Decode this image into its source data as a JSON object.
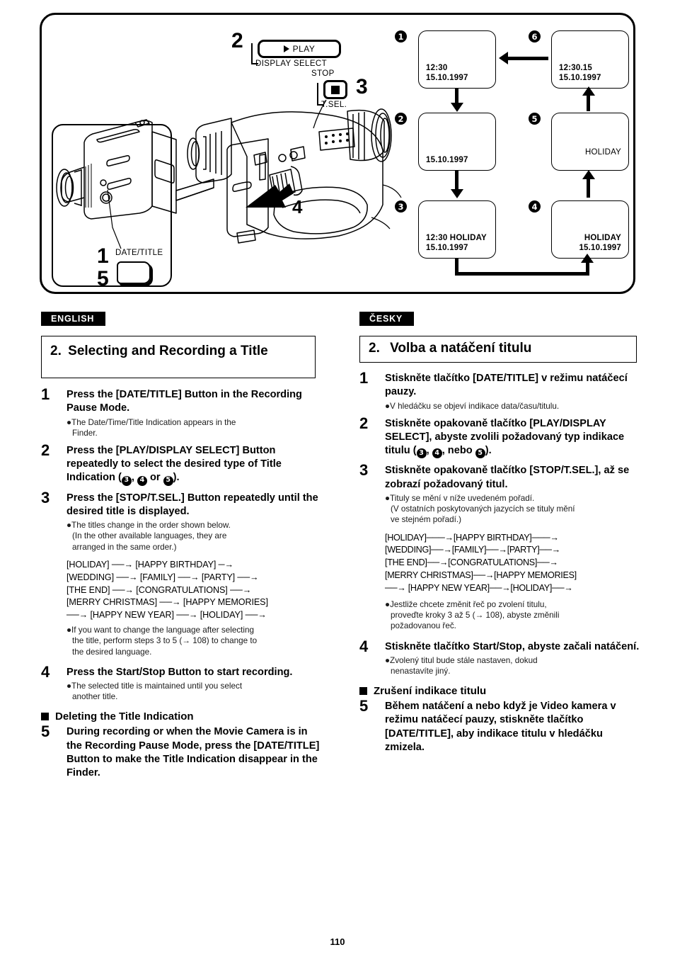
{
  "illustration": {
    "buttons": {
      "play_label": "PLAY",
      "play_sub_label": "DISPLAY SELECT",
      "play_step_num": "2",
      "stop_top_label": "STOP",
      "stop_sub_label": "T.SEL.",
      "stop_step_num": "3"
    },
    "camera_callouts": {
      "date_title_label": "DATE/TITLE",
      "num_1": "1",
      "num_5": "5",
      "num_4": "4"
    },
    "finder_screens": [
      {
        "num": "1",
        "marker": "❶",
        "align": "left",
        "lines": [
          "12:30",
          "15.10.1997"
        ]
      },
      {
        "num": "2",
        "marker": "❷",
        "align": "left",
        "lines": [
          "15.10.1997"
        ]
      },
      {
        "num": "3",
        "marker": "❸",
        "align": "left",
        "lines": [
          "12:30   HOLIDAY",
          "15.10.1997"
        ]
      },
      {
        "num": "4",
        "marker": "❹",
        "align": "right",
        "lines": [
          "HOLIDAY",
          "15.10.1997"
        ]
      },
      {
        "num": "5",
        "marker": "❺",
        "align": "right",
        "lines": [
          "HOLIDAY"
        ]
      },
      {
        "num": "6",
        "marker": "❻",
        "align": "left",
        "lines": [
          "12:30.15",
          "15.10.1997"
        ]
      }
    ]
  },
  "english": {
    "lang_tag": "ENGLISH",
    "section_number": "2.",
    "section_title": "Selecting and Recording a Title",
    "steps": [
      {
        "n": "1",
        "head": "Press the [DATE/TITLE] Button in the Recording Pause Mode.",
        "notes": [
          "●The Date/Time/Title Indication appears in the",
          "Finder."
        ]
      },
      {
        "n": "2",
        "head_pre": "Press the [PLAY/DISPLAY SELECT] Button repeatedly to select the desired type of Title Indication (",
        "head_post": ").",
        "head_mid_1": ", ",
        "head_mid_2": " or ",
        "circle_a": "3",
        "circle_b": "4",
        "circle_c": "5"
      },
      {
        "n": "3",
        "head": "Press the [STOP/T.SEL.] Button repeatedly until the desired title is displayed.",
        "notes": [
          "●The titles change in the order shown below.",
          "(In the other available languages, they are",
          "arranged in the same order.)"
        ],
        "sequence": [
          "[HOLIDAY] ──→ [HAPPY BIRTHDAY] ─→",
          "[WEDDING] ──→ [FAMILY] ──→ [PARTY] ──→",
          "[THE END] ──→ [CONGRATULATIONS] ──→",
          "[MERRY CHRISTMAS] ──→ [HAPPY MEMORIES]",
          "──→ [HAPPY NEW YEAR] ──→ [HOLIDAY] ──→"
        ],
        "notes2": [
          "●If you want to change the language after selecting",
          "the title, perform steps 3 to 5 (→ 108) to change to",
          "the desired language."
        ]
      },
      {
        "n": "4",
        "head": "Press the Start/Stop Button to start recording.",
        "notes": [
          "●The selected title is maintained until you select",
          "another title."
        ]
      }
    ],
    "subhead": "Deleting the Title Indication",
    "step5": {
      "n": "5",
      "head": "During recording or when the Movie Camera is in the Recording Pause Mode, press the [DATE/TITLE] Button to make the Title Indication disappear in the Finder."
    }
  },
  "czech": {
    "lang_tag": "ČESKY",
    "section_number": "2.",
    "section_title": "Volba a natáčení titulu",
    "steps": [
      {
        "n": "1",
        "head": "Stiskněte tlačítko [DATE/TITLE] v režimu natáčecí pauzy.",
        "notes": [
          "●V hledáčku se objeví indikace data/času/titulu."
        ]
      },
      {
        "n": "2",
        "head_pre": "Stiskněte opakovaně tlačítko [PLAY/DISPLAY SELECT], abyste zvolili požadovaný typ indikace titulu (",
        "head_mid_1": ", ",
        "head_mid_2": ", nebo ",
        "head_post": ").",
        "circle_a": "3",
        "circle_b": "4",
        "circle_c": "5"
      },
      {
        "n": "3",
        "head": "Stiskněte opakovaně tlačítko [STOP/T.SEL.], až se zobrazí požadovaný titul.",
        "notes": [
          "●Tituly se mění v níže uvedeném pořadí.",
          "(V ostatních poskytovaných jazycích se tituly mění",
          "ve stejném pořadí.)"
        ],
        "sequence": [
          "[HOLIDAY]───→[HAPPY BIRTHDAY]───→",
          "[WEDDING]──→[FAMILY]──→[PARTY]──→",
          "[THE END]──→[CONGRATULATIONS]──→",
          "[MERRY CHRISTMAS]──→[HAPPY MEMORIES]",
          "──→ [HAPPY NEW YEAR]──→[HOLIDAY]──→"
        ],
        "notes2": [
          "●Jestliže chcete změnit řeč po zvolení titulu,",
          "proveďte kroky 3 až 5 (→ 108), abyste změnili",
          "požadovanou řeč."
        ]
      },
      {
        "n": "4",
        "head": "Stiskněte tlačítko Start/Stop, abyste začali natáčení.",
        "notes": [
          "●Zvolený titul bude stále nastaven, dokud",
          "nenastavíte jiný."
        ]
      }
    ],
    "subhead": "Zrušení indikace titulu",
    "step5": {
      "n": "5",
      "head": "Během natáčení a nebo když je Video kamera v režimu natáčecí pauzy, stiskněte tlačítko [DATE/TITLE], aby indikace titulu v hledáčku zmizela."
    }
  },
  "page_number": "110"
}
